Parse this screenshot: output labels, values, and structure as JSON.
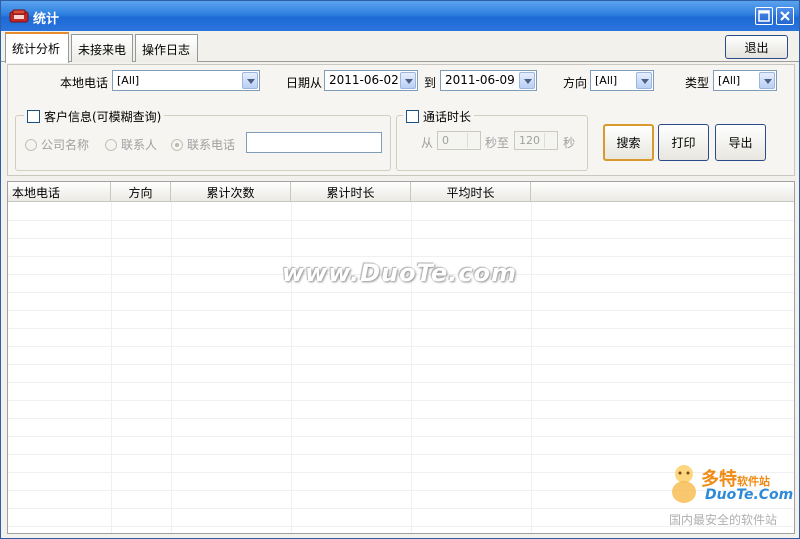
{
  "window": {
    "title": "统计"
  },
  "tabs": [
    {
      "label": "统计分析",
      "active": true
    },
    {
      "label": "未接来电",
      "active": false
    },
    {
      "label": "操作日志",
      "active": false
    }
  ],
  "toolbar": {
    "exit_label": "退出"
  },
  "filters": {
    "local_phone_label": "本地电话",
    "local_phone_value": "[All]",
    "date_from_label": "日期从",
    "date_from_value": "2011-06-02",
    "date_to_label": "到",
    "date_to_value": "2011-06-09",
    "direction_label": "方向",
    "direction_value": "[All]",
    "type_label": "类型",
    "type_value": "[All]"
  },
  "customer_info": {
    "title": "客户信息(可模糊查询)",
    "checked": false,
    "options": [
      {
        "label": "公司名称",
        "checked": false
      },
      {
        "label": "联系人",
        "checked": false
      },
      {
        "label": "联系电话",
        "checked": true
      }
    ],
    "query_value": ""
  },
  "call_duration": {
    "title": "通话时长",
    "checked": false,
    "from_label": "从",
    "from_value": "0",
    "seconds_to_label": "秒至",
    "to_value": "120",
    "seconds_label": "秒"
  },
  "actions": {
    "search_label": "搜索",
    "print_label": "打印",
    "export_label": "导出"
  },
  "table": {
    "columns": [
      "本地电话",
      "方向",
      "累计次数",
      "累计时长",
      "平均时长"
    ],
    "rows": []
  },
  "watermark": {
    "text": "www.DuoTe.com"
  },
  "logo": {
    "cn": "多特",
    "cn_small": "软件站",
    "en": "DuoTe.Com",
    "sub": "国内最安全的软件站"
  },
  "colors": {
    "titlebar": "#2e7fe0",
    "tab_active_accent": "#e68b2c",
    "default_button_border": "#d99a2d"
  }
}
